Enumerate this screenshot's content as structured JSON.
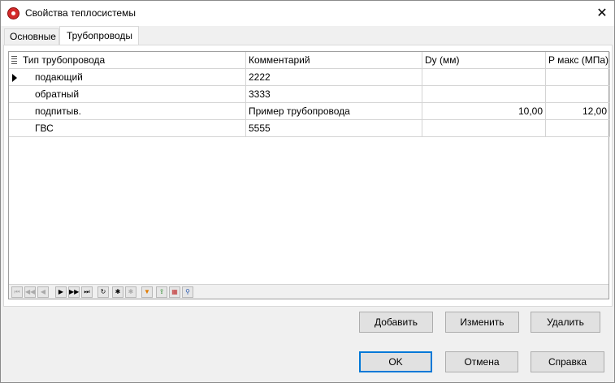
{
  "window": {
    "title": "Свойства теплосистемы"
  },
  "titlebar": {
    "close_glyph": "✕"
  },
  "tabs": [
    {
      "label": "Основные"
    },
    {
      "label": "Трубопроводы"
    }
  ],
  "grid": {
    "columns": [
      "Тип трубопровода",
      "Комментарий",
      "Dy (мм)",
      "P макс (МПа)"
    ],
    "rows": [
      {
        "type": "подающий",
        "comment": "2222",
        "dy": "",
        "pmax": ""
      },
      {
        "type": "обратный",
        "comment": "3333",
        "dy": "",
        "pmax": ""
      },
      {
        "type": "подпитыв.",
        "comment": "Пример трубопровода",
        "dy": "10,00",
        "pmax": "12,00"
      },
      {
        "type": "ГВС",
        "comment": "5555",
        "dy": "",
        "pmax": ""
      }
    ]
  },
  "navigator": {
    "buttons": [
      {
        "name": "first",
        "glyph": "⏮"
      },
      {
        "name": "prior-page",
        "glyph": "◀◀"
      },
      {
        "name": "prior",
        "glyph": "◀"
      },
      {
        "name": "next",
        "glyph": "▶"
      },
      {
        "name": "next-page",
        "glyph": "▶▶"
      },
      {
        "name": "last",
        "glyph": "⏭"
      },
      {
        "name": "refresh",
        "glyph": "↻"
      },
      {
        "name": "insert",
        "glyph": "✱"
      },
      {
        "name": "delete",
        "glyph": "✱"
      },
      {
        "name": "filter",
        "glyph": "▼"
      },
      {
        "name": "export",
        "glyph": "⇪"
      },
      {
        "name": "grid-setup",
        "glyph": "▦"
      },
      {
        "name": "find",
        "glyph": "⚲"
      }
    ]
  },
  "actions": {
    "add": "Добавить",
    "edit": "Изменить",
    "delete": "Удалить"
  },
  "footer": {
    "ok": "OK",
    "cancel": "Отмена",
    "help": "Справка"
  },
  "colors": {
    "accent": "#0078d7",
    "icon_red": "#d42a2a"
  }
}
